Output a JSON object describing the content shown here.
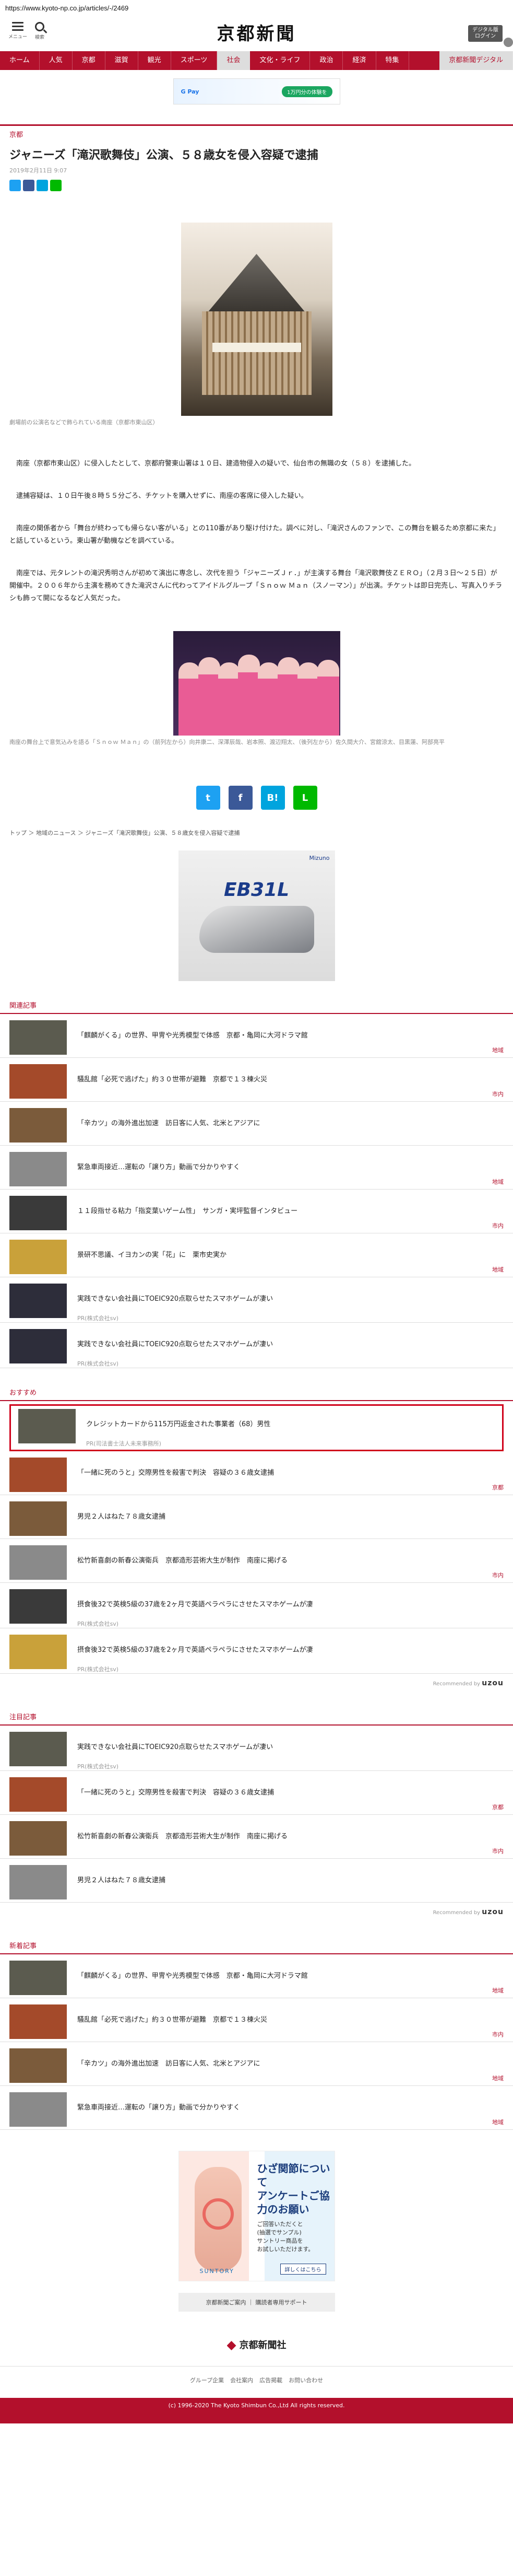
{
  "browser": {
    "url": "https://www.kyoto-np.co.jp/articles/-/2469"
  },
  "header": {
    "logo": "京都新聞",
    "menu_label": "メニュー",
    "search_label": "検索",
    "digital_btn": "デジタル版\nログイン"
  },
  "nav": {
    "items": [
      "ホーム",
      "人気",
      "京都",
      "滋賀",
      "観光",
      "スポーツ",
      "社会",
      "文化・ライフ",
      "政治",
      "経済",
      "特集"
    ],
    "active_index": 6,
    "special": "京都新聞デジタル"
  },
  "ad_top": {
    "pill": "1万円分の体験を",
    "brand": "G Pay"
  },
  "article": {
    "category": "京都",
    "title": "ジャニーズ「滝沢歌舞伎」公演、５８歳女を侵入容疑で逮捕",
    "date": "2019年2月11日 9:07",
    "photo1_caption": "劇場前の公演名などで飾られている南座（京都市東山区）",
    "paragraphs": [
      "南座（京都市東山区）に侵入したとして、京都府警東山署は１０日、建造物侵入の疑いで、仙台市の無職の女（５８）を逮捕した。",
      "逮捕容疑は、１０日午後８時５５分ごろ、チケットを購入せずに、南座の客席に侵入した疑い。",
      "南座の関係者から「舞台が終わっても帰らない客がいる」との110番があり駆け付けた。調べに対し、「滝沢さんのファンで、この舞台を観るため京都に来た」と話しているという。東山署が動機などを調べている。",
      "南座では、元タレントの滝沢秀明さんが初めて演出に専念し、次代を担う「ジャニーズＪｒ．」が主演する舞台「滝沢歌舞伎ＺＥＲＯ」（２月３日～２５日）が開催中。２００６年から主演を務めてきた滝沢さんに代わってアイドルグループ「Ｓｎｏｗ Ｍａｎ（スノーマン）」が出演。チケットは即日完売し、写真入りチラシも飾って開になるなど人気だった。"
    ],
    "photo2_caption": "南座の舞台上で意気込みを語る「Ｓｎｏｗ Ｍａｎ」の（前列左から）向井康二、深澤辰哉、岩本照、渡辺翔太、（後列左から）佐久間大介、宮舘涼太、目黒蓮、阿部亮平",
    "share_big": [
      "t",
      "f",
      "B!",
      "L"
    ],
    "breadcrumb": "トップ ＞ 地域のニュース ＞ ジャニーズ「滝沢歌舞伎」公演、５８歳女を侵入容疑で逮捕"
  },
  "ad_mid": {
    "brand": "Mizuno",
    "model": "EB31L"
  },
  "related": {
    "heading": "関連記事",
    "items": [
      {
        "title": "「麒麟がくる」の世界、甲冑や光秀模型で体感　京都・亀岡に大河ドラマ館",
        "tag": "地域"
      },
      {
        "title": "騒乱館「必死で逃げた」約３０世帯が避難　京都で１３棟火災",
        "tag": "市内"
      },
      {
        "title": "「辛カツ」の海外進出加速　訪日客に人気、北米とアジアに",
        "tag": ""
      },
      {
        "title": "緊急車両接近…運転の「譲り方」動画で分かりやすく",
        "tag": "地域"
      },
      {
        "title": "１１段指せる粘力「指変葉いゲーム性」　サンガ・実坪監督インタビュー",
        "tag": "市内"
      },
      {
        "title": "景研不思議、イヨカンの実「花」に　栗市史実か",
        "tag": "地域"
      },
      {
        "title": "実践できない会社員にTOEIC920点取らせたスマホゲームが凄い",
        "sub": "PR(株式会社sv)"
      },
      {
        "title": "実践できない会社員にTOEIC920点取らせたスマホゲームが凄い",
        "sub": "PR(株式会社sv)"
      }
    ]
  },
  "recommend": {
    "heading": "おすすめ",
    "items": [
      {
        "title": "クレジットカードから115万円返金された事業者（68）男性",
        "sub": "PR(司法書士法人未来事務所)",
        "highlight": true
      },
      {
        "title": "「一緒に死のうと」交際男性を殺害で判決　容疑の３６歳女逮捕",
        "tag": "京都"
      },
      {
        "title": "男児２人はねた７８歳女逮捕",
        "tag": ""
      },
      {
        "title": "松竹新喜劇の新春公演衛兵　京都造形芸術大生が制作　南座に掲げる",
        "tag": "市内"
      },
      {
        "title": "摂食後32で英検5級の37歳を2ヶ月で英語ペラペラにさせたスマホゲームが凄",
        "sub": "PR(株式会社sv)"
      },
      {
        "title": "摂食後32で英検5級の37歳を2ヶ月で英語ペラペラにさせたスマホゲームが凄",
        "sub": "PR(株式会社sv)"
      }
    ],
    "powered": "Recommended by",
    "powered_brand": "uzou"
  },
  "attention": {
    "heading": "注目記事",
    "items": [
      {
        "title": "実践できない会社員にTOEIC920点取らせたスマホゲームが凄い",
        "sub": "PR(株式会社sv)"
      },
      {
        "title": "「一緒に死のうと」交際男性を殺害で判決　容疑の３６歳女逮捕",
        "tag": "京都"
      },
      {
        "title": "松竹新喜劇の新春公演衛兵　京都造形芸術大生が制作　南座に掲げる",
        "tag": "市内"
      },
      {
        "title": "男児２人はねた７８歳女逮捕",
        "tag": ""
      }
    ],
    "powered": "Recommended by",
    "powered_brand": "uzou"
  },
  "latest": {
    "heading": "新着記事",
    "items": [
      {
        "title": "「麒麟がくる」の世界、甲冑や光秀模型で体感　京都・亀岡に大河ドラマ館",
        "tag": "地域"
      },
      {
        "title": "騒乱館「必死で逃げた」約３０世帯が避難　京都で１３棟火災",
        "tag": "市内"
      },
      {
        "title": "「辛カツ」の海外進出加速　訪日客に人気、北米とアジアに",
        "tag": "地域"
      },
      {
        "title": "緊急車両接近…運転の「譲り方」動画で分かりやすく",
        "tag": "地域"
      }
    ]
  },
  "ad_bottom": {
    "headline": "ひざ関節について\nアンケートご協力のお願い",
    "body": "ご回答いただくと\n(抽選でサンプル)\nサントリー商品を\nお試しいただけます。",
    "brand": "SUNTORY",
    "detail": "詳しくはこちら"
  },
  "footer": {
    "links": "京都新聞ご案内 ｜ 購読者専用サポート",
    "logo": "京都新聞社",
    "nav": [
      "グループ企業",
      "会社案内",
      "広告掲載",
      "お問い合わせ"
    ],
    "copyright": "(c) 1996-2020 The Kyoto Shimbun Co.,Ltd All rights reserved."
  }
}
